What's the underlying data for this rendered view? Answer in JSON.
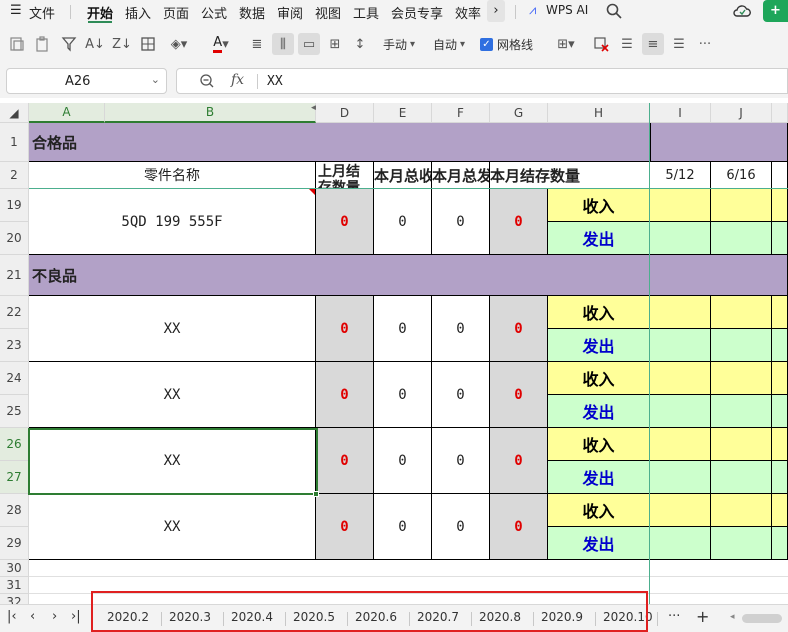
{
  "menu": {
    "file_icon": "hamburger-icon",
    "items": [
      "文件",
      "开始",
      "插入",
      "页面",
      "公式",
      "数据",
      "审阅",
      "视图",
      "工具",
      "会员专享",
      "效率"
    ],
    "active": "开始",
    "wps_ai": "WPS AI"
  },
  "toolbar": {
    "row_height_label": "手动",
    "col_width_label": "自动",
    "gridlines_label": "网格线",
    "gridlines_checked": true
  },
  "formula_bar": {
    "name_box": "A26",
    "fx_label": "fx",
    "content": "XX"
  },
  "columns": [
    "A",
    "B",
    "D",
    "E",
    "F",
    "G",
    "H",
    "I",
    "J"
  ],
  "rows": [
    "1",
    "2",
    "19",
    "20",
    "21",
    "22",
    "23",
    "24",
    "25",
    "26",
    "27",
    "28",
    "29",
    "30",
    "31",
    "32"
  ],
  "sheet": {
    "title_good": "合格品",
    "header_part_name": "零件名称",
    "header_last_month": "上月结存数量",
    "header_in_total": "本月总收",
    "header_out_total": "本月总发",
    "header_month_end": "本月结存数量",
    "date_i": "5/12",
    "date_j": "6/16",
    "title_bad": "不良品",
    "in_label": "收入",
    "out_label": "发出",
    "parts": [
      {
        "name": "5QD 199 555F",
        "d": "0",
        "e": "0",
        "f": "0",
        "g": "0"
      },
      {
        "name": "XX",
        "d": "0",
        "e": "0",
        "f": "0",
        "g": "0"
      },
      {
        "name": "XX",
        "d": "0",
        "e": "0",
        "f": "0",
        "g": "0"
      },
      {
        "name": "XX",
        "d": "0",
        "e": "0",
        "f": "0",
        "g": "0"
      },
      {
        "name": "XX",
        "d": "0",
        "e": "0",
        "f": "0",
        "g": "0"
      }
    ]
  },
  "tabs": [
    "2020.2",
    "2020.3",
    "2020.4",
    "2020.5",
    "2020.6",
    "2020.7",
    "2020.8",
    "2020.9",
    "2020.10"
  ],
  "tab_more": "···",
  "tab_add": "+",
  "colors": {
    "purple_fill": "#b2a1c7",
    "gray_fill": "#d9d9d9",
    "yellow_fill": "#ffff99",
    "green_fill": "#ccffcc",
    "red_text": "#e00000",
    "blue_text": "#0000cc",
    "selection_green": "#2e7d32",
    "highlight_box": "#e02020"
  }
}
